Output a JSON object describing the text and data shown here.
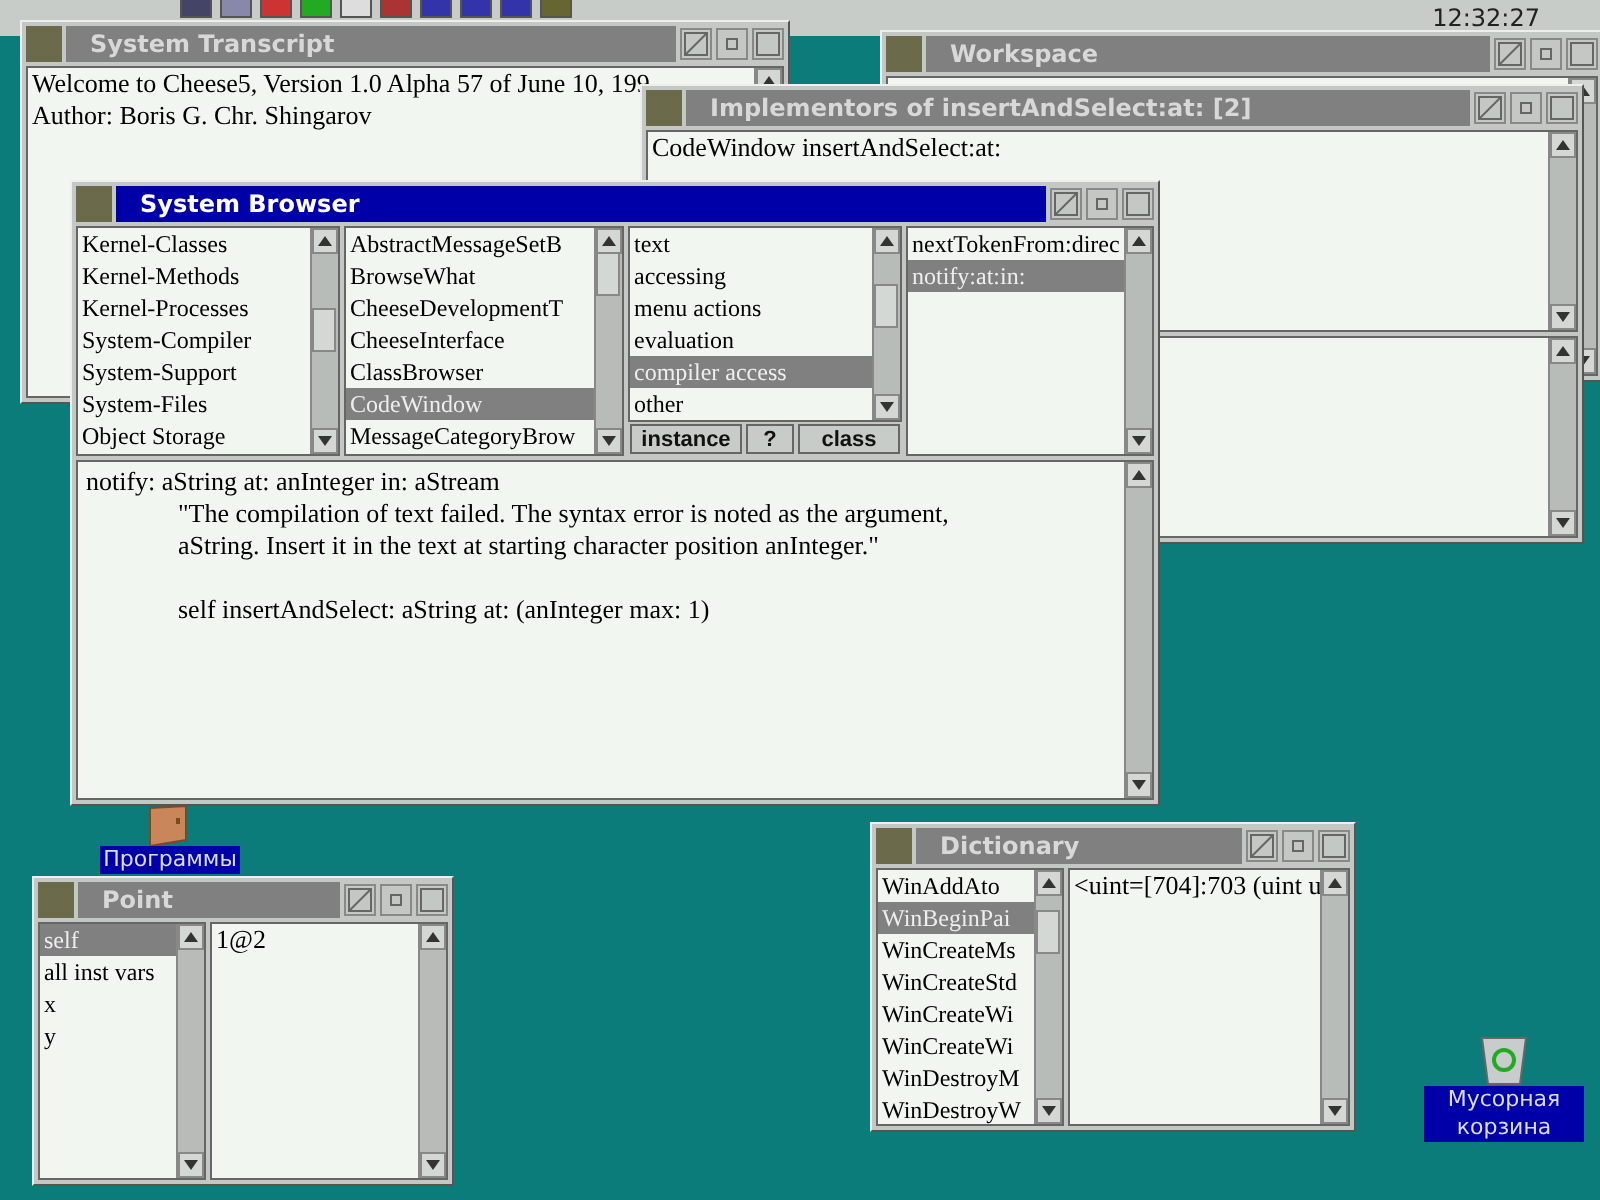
{
  "taskbar": {
    "clock": "12:32:27"
  },
  "desktop_icons": [
    {
      "kind": "folder",
      "label": "Программы"
    },
    {
      "kind": "trash",
      "label": "Мусорная корзина"
    }
  ],
  "system_transcript": {
    "title": "System Transcript",
    "active": false,
    "lines": [
      "Welcome to Cheese5,  Version 1.0  Alpha 57 of June 10, 199",
      "Author: Boris G. Chr. Shingarov"
    ]
  },
  "workspace": {
    "title": "Workspace",
    "active": false
  },
  "implementors": {
    "title": "Implementors of insertAndSelect:at: [2]",
    "active": false,
    "items": [
      "CodeWindow insertAndSelect:at:"
    ]
  },
  "system_browser": {
    "title": "System Browser",
    "active": true,
    "categories": [
      {
        "label": "Kernel-Classes",
        "selected": false
      },
      {
        "label": "Kernel-Methods",
        "selected": false
      },
      {
        "label": "Kernel-Processes",
        "selected": false
      },
      {
        "label": "System-Compiler",
        "selected": false
      },
      {
        "label": "System-Support",
        "selected": false
      },
      {
        "label": "System-Files",
        "selected": false
      },
      {
        "label": "Object Storage",
        "selected": false
      }
    ],
    "classes": [
      {
        "label": "AbstractMessageSetB",
        "selected": false
      },
      {
        "label": "BrowseWhat",
        "selected": false
      },
      {
        "label": "CheeseDevelopmentT",
        "selected": false
      },
      {
        "label": "CheeseInterface",
        "selected": false
      },
      {
        "label": "ClassBrowser",
        "selected": false
      },
      {
        "label": "CodeWindow",
        "selected": true
      },
      {
        "label": "MessageCategoryBrow",
        "selected": false
      }
    ],
    "protocols": [
      {
        "label": "text",
        "selected": false
      },
      {
        "label": "accessing",
        "selected": false
      },
      {
        "label": "menu actions",
        "selected": false
      },
      {
        "label": "evaluation",
        "selected": false
      },
      {
        "label": "compiler access",
        "selected": true
      },
      {
        "label": "other",
        "selected": false
      }
    ],
    "buttons": [
      "instance",
      "?",
      "class"
    ],
    "methods": [
      {
        "label": "nextTokenFrom:direc",
        "selected": false
      },
      {
        "label": "notify:at:in:",
        "selected": true
      }
    ],
    "code": [
      {
        "kind": "signature",
        "text": "notify: aString at: anInteger in: aStream"
      },
      {
        "kind": "comment",
        "text": "\"The compilation of text failed. The syntax error is noted as the argument,"
      },
      {
        "kind": "comment",
        "text": "aString. Insert it in the text at starting character position anInteger.\""
      },
      {
        "kind": "statement",
        "text": "self insertAndSelect: aString at: (anInteger max: 1)"
      }
    ]
  },
  "point_inspector": {
    "title": "Point",
    "active": false,
    "fields": [
      {
        "label": "self",
        "selected": true
      },
      {
        "label": "all inst vars",
        "selected": false
      },
      {
        "label": "x",
        "selected": false
      },
      {
        "label": "y",
        "selected": false
      }
    ],
    "value": "1@2"
  },
  "dictionary": {
    "title": "Dictionary",
    "active": false,
    "keys": [
      {
        "label": "WinAddAto",
        "selected": false
      },
      {
        "label": "WinBeginPai",
        "selected": true
      },
      {
        "label": "WinCreateMs",
        "selected": false
      },
      {
        "label": "WinCreateStd",
        "selected": false
      },
      {
        "label": "WinCreateWi",
        "selected": false
      },
      {
        "label": "WinCreateWi",
        "selected": false
      },
      {
        "label": "WinDestroyM",
        "selected": false
      },
      {
        "label": "WinDestroyW",
        "selected": false
      }
    ],
    "value": "<uint=[704]:703 (uint u"
  }
}
